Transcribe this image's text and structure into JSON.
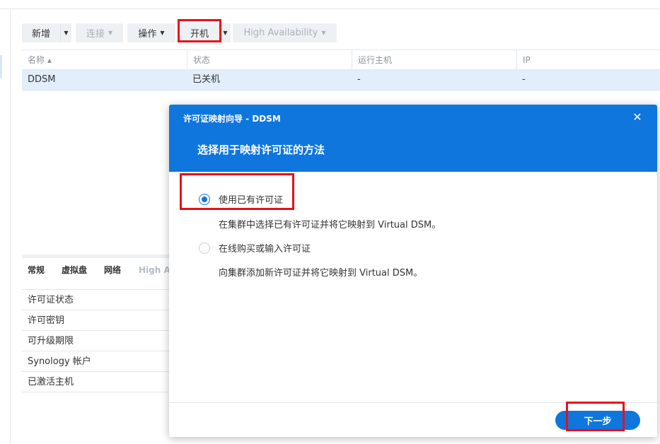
{
  "toolbar": {
    "create_label": "新增",
    "connect_label": "连接",
    "action_label": "操作",
    "power_on_label": "开机",
    "high_availability_label": "High Availability"
  },
  "grid": {
    "columns": [
      "名称 ▴",
      "状态",
      "运行主机",
      "IP"
    ],
    "rows": [
      {
        "name": "DDSM",
        "status": "已关机",
        "host": "-",
        "ip": "-"
      }
    ]
  },
  "detail": {
    "tabs": [
      "常规",
      "虚拟盘",
      "网络",
      "High A"
    ],
    "rows": [
      "许可证状态",
      "许可密钥",
      "可升级期限",
      "Synology 帐户",
      "已激活主机"
    ]
  },
  "dialog": {
    "title": "许可证映射向导 - DDSM",
    "subtitle": "选择用于映射许可证的方法",
    "options": [
      {
        "label": "使用已有许可证",
        "description": "在集群中选择已有许可证并将它映射到 Virtual DSM。",
        "checked": true
      },
      {
        "label": "在线购买或输入许可证",
        "description": "向集群添加新许可证并将它映射到 Virtual DSM。",
        "checked": false
      }
    ],
    "next_label": "下一步",
    "close_icon": "close-icon"
  },
  "colors": {
    "accent": "#0f76de",
    "highlight_box": "#e8101a",
    "selected_row": "#e2eefb"
  }
}
